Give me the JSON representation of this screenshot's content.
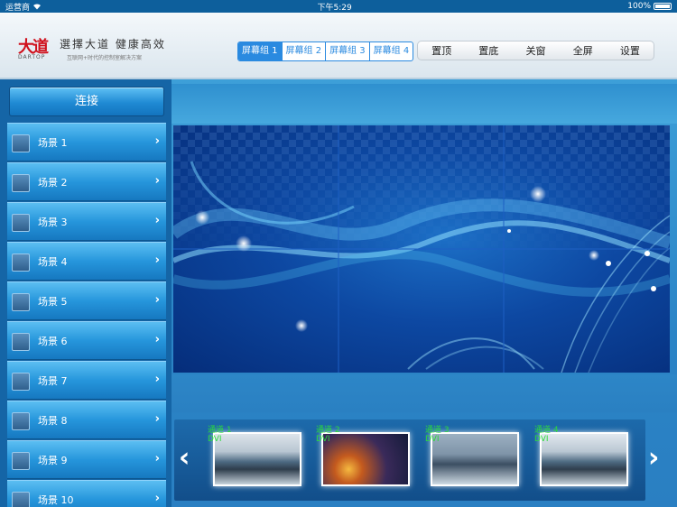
{
  "status_bar": {
    "carrier": "运营商",
    "wifi_icon": "wifi-icon",
    "time": "下午5:29",
    "battery": "100%"
  },
  "header": {
    "logo_text": "大道",
    "logo_en": "DARTOP",
    "slogan": "選擇大道 健康高效",
    "slogan_sub": "互联网+时代的控制室解决方案",
    "screen_groups": [
      "屏幕组 1",
      "屏幕组 2",
      "屏幕组 3",
      "屏幕组 4"
    ],
    "active_group": 0,
    "actions": [
      "置顶",
      "置底",
      "关窗",
      "全屏",
      "设置"
    ]
  },
  "sidebar": {
    "connect_label": "连接",
    "scenes": [
      "场景 1",
      "场景 2",
      "场景 3",
      "场景 4",
      "场景 5",
      "场景 6",
      "场景 7",
      "场景 8",
      "场景 9",
      "场景 10"
    ]
  },
  "channels": {
    "prev_icon": "chevron-left-icon",
    "next_icon": "chevron-right-icon",
    "items": [
      {
        "name": "通道 1",
        "type": "DVI"
      },
      {
        "name": "通道 2",
        "type": "DVI"
      },
      {
        "name": "通道 3",
        "type": "DVI"
      },
      {
        "name": "通道 4",
        "type": "DVI"
      }
    ]
  },
  "colors": {
    "accent": "#2a8ae0",
    "channel_label": "#2bdc3a",
    "sidebar": "#1565a6"
  }
}
